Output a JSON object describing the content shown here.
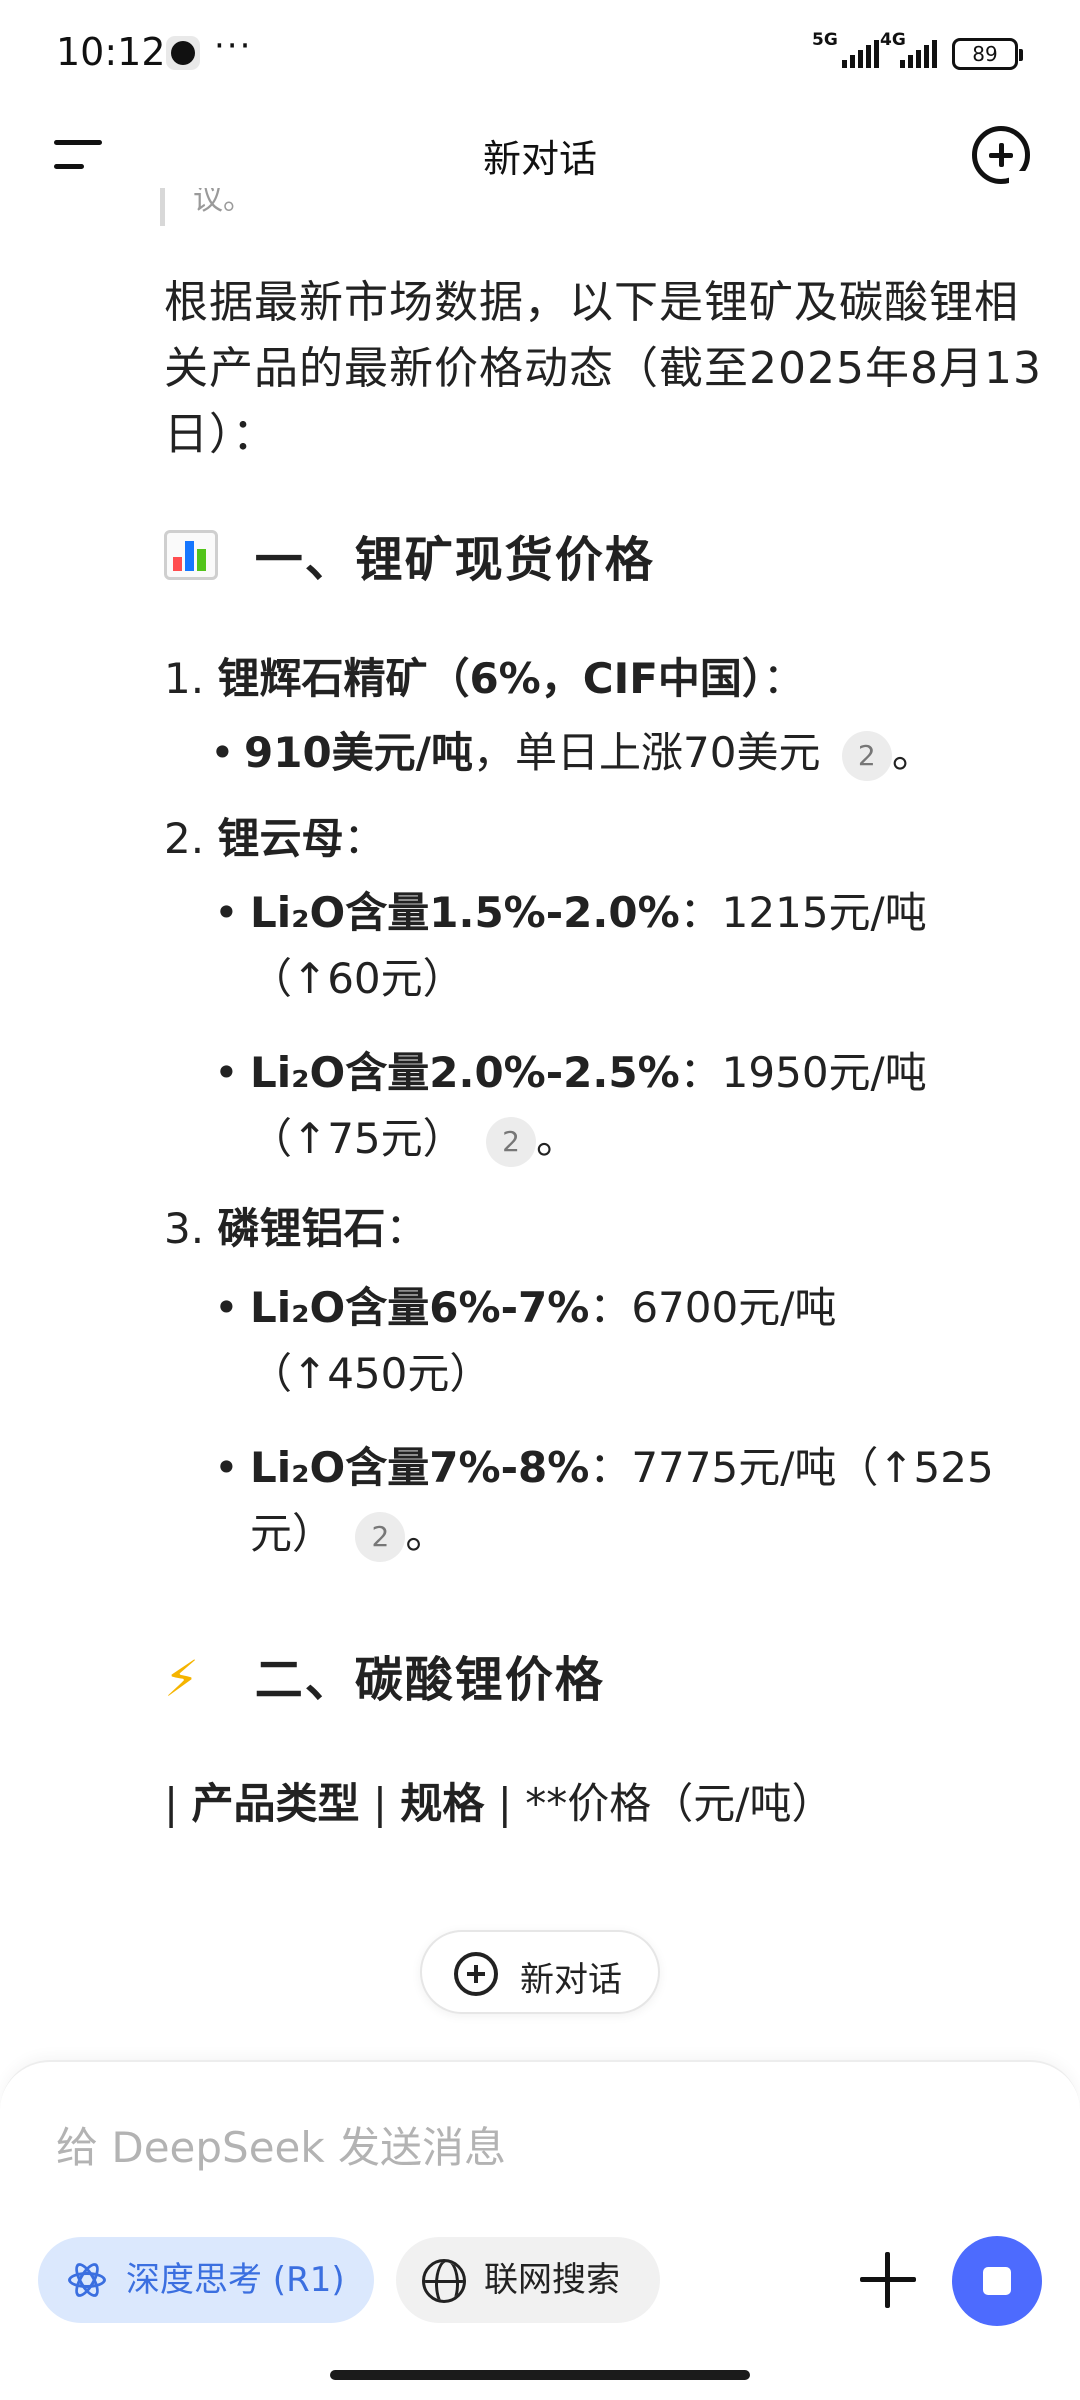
{
  "status_bar": {
    "time": "10:12",
    "more": "···",
    "net1": "5G",
    "net2": "4G",
    "battery": "89"
  },
  "header": {
    "title": "新对话"
  },
  "content": {
    "quote_fragment": "议。",
    "intro": "根据最新市场数据，以下是锂矿及碳酸锂相关产品的最新价格动态（截至2025年8月13日）：",
    "section1": {
      "emoji": "bar-chart-icon",
      "title": "一、锂矿现货价格"
    },
    "items": [
      {
        "num": "1.",
        "title": "锂辉石精矿（6%，CIF中国）",
        "colon": "：",
        "bullets": [
          {
            "bold": "910美元/吨",
            "text": "，单日上涨70美元",
            "cite": "2",
            "end": "。"
          }
        ]
      },
      {
        "num": "2.",
        "title": "锂云母",
        "colon": "：",
        "bullets": [
          {
            "bold": "Li₂O含量1.5%-2.0%",
            "text": "：1215元/吨",
            "line2": "（↑60元）"
          },
          {
            "bold": "Li₂O含量2.0%-2.5%",
            "text": "：1950元/吨",
            "line2": "（↑75元）",
            "cite": "2",
            "end": "。"
          }
        ]
      },
      {
        "num": "3.",
        "title": "磷锂铝石",
        "colon": "：",
        "bullets": [
          {
            "bold": "Li₂O含量6%-7%",
            "text": "：6700元/吨",
            "line2": "（↑450元）"
          },
          {
            "bold": "Li₂O含量7%-8%",
            "text": "：7775元/吨（↑525",
            "line2": "元）",
            "cite": "2",
            "end": "。"
          }
        ]
      }
    ],
    "section2": {
      "emoji": "⚡",
      "title": "二、碳酸锂价格"
    },
    "table_fragment": {
      "bar1": "|",
      "col1": "产品类型",
      "bar2": "|",
      "col2": "规格",
      "bar3": "|",
      "col3": "**价格（元/吨）"
    }
  },
  "float_button": {
    "label": "新对话"
  },
  "composer": {
    "placeholder": "给 DeepSeek 发送消息",
    "deep_think": "深度思考 (R1)",
    "web_search": "联网搜索"
  },
  "colors": {
    "accent": "#4d6bfe",
    "deep_pill_bg": "#dbe8fd",
    "deep_pill_text": "#3b6fe0"
  }
}
